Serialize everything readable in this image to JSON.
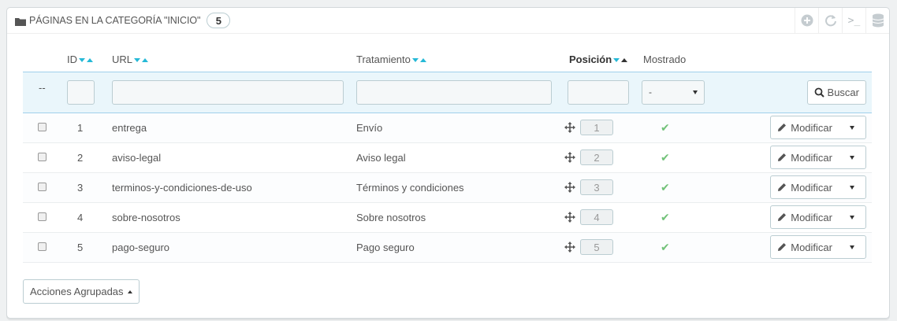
{
  "panel": {
    "title": "Páginas en la categoría \"Inicio\"",
    "count": "5",
    "toolbar": [
      "add-icon",
      "refresh-icon",
      "terminal-icon",
      "database-icon"
    ]
  },
  "columns": {
    "id": "ID",
    "url": "URL",
    "title": "Tratamiento",
    "position": "Posición",
    "displayed": "Mostrado"
  },
  "filters": {
    "dash": "--",
    "displayed_value": "-",
    "search_label": "Buscar"
  },
  "rows": [
    {
      "id": "1",
      "url": "entrega",
      "title": "Envío",
      "position": "1"
    },
    {
      "id": "2",
      "url": "aviso-legal",
      "title": "Aviso legal",
      "position": "2"
    },
    {
      "id": "3",
      "url": "terminos-y-condiciones-de-uso",
      "title": "Términos y condiciones",
      "position": "3"
    },
    {
      "id": "4",
      "url": "sobre-nosotros",
      "title": "Sobre nosotros",
      "position": "4"
    },
    {
      "id": "5",
      "url": "pago-seguro",
      "title": "Pago seguro",
      "position": "5"
    }
  ],
  "row_action_label": "Modificar",
  "bulk_actions_label": "Acciones Agrupadas",
  "colors": {
    "accent": "#25b9d7",
    "success": "#72c279"
  }
}
